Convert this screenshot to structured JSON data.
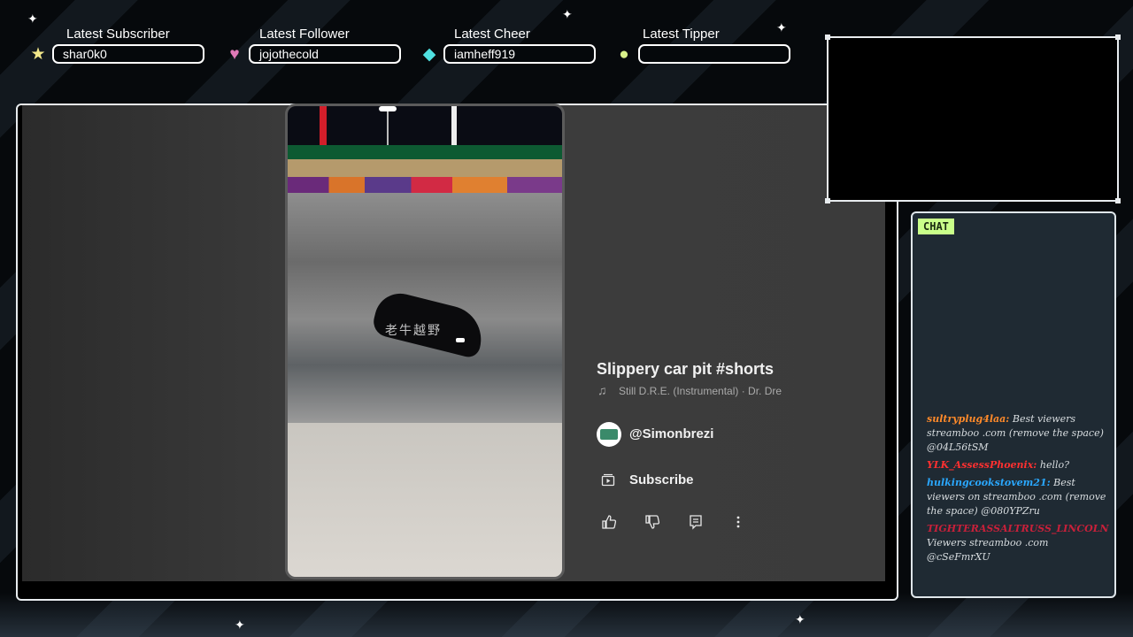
{
  "alerts": [
    {
      "label": "Latest Subscriber",
      "value": "shar0k0",
      "icon": "star-icon",
      "color": "#f3e88a"
    },
    {
      "label": "Latest Follower",
      "value": "jojothecold",
      "icon": "heart-icon",
      "color": "#e07ab8"
    },
    {
      "label": "Latest Cheer",
      "value": "iamheff919",
      "icon": "gem-icon",
      "color": "#4fe0e0"
    },
    {
      "label": "Latest Tipper",
      "value": "",
      "icon": "coin-icon",
      "color": "#d8f08a"
    }
  ],
  "video": {
    "watermark": "老牛越野",
    "title": "Slippery car pit #shorts",
    "music": "Still D.R.E. (Instrumental) · Dr. Dre",
    "channel": "@Simonbrezi",
    "subscribe_label": "Subscribe",
    "actions": [
      "like-icon",
      "dislike-icon",
      "comments-icon",
      "more-icon"
    ]
  },
  "chat": {
    "tag": "CHAT",
    "messages": [
      {
        "user": "sultryplug4laa:",
        "text": " Best viewers streamboo .com (remove the space) @04L56tSM",
        "color": "#ff8a2a"
      },
      {
        "user": "YLK_AssessPhoenix:",
        "text": " hello?",
        "color": "#ff3030"
      },
      {
        "user": "hulkingcookstovem21:",
        "text": " Best viewers on streamboo .com (remove the space) @080YPZru",
        "color": "#2aa8ff"
      },
      {
        "user": "TIGHTERASSALTRUSS_LINCOLN",
        "text": " Viewers streamboo .com @cSeFmrXU",
        "color": "#c8203a"
      }
    ]
  }
}
